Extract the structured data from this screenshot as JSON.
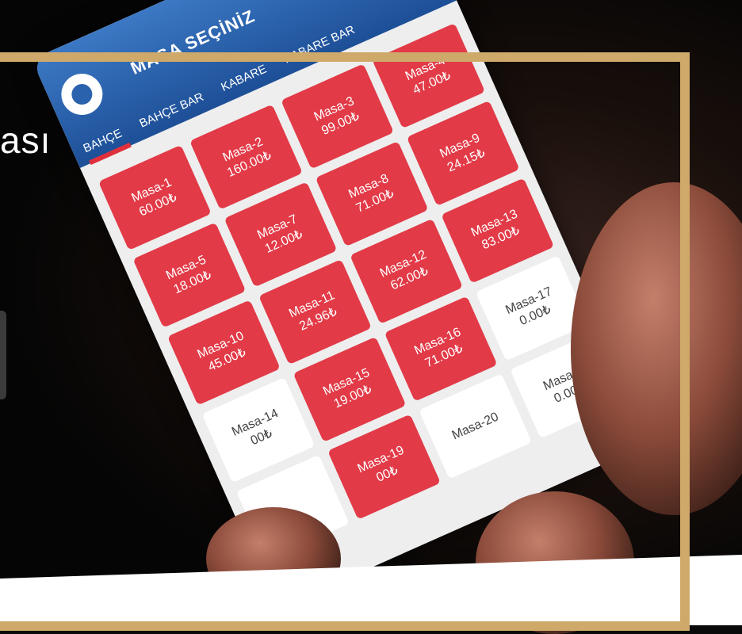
{
  "heading": "ası",
  "app": {
    "title": "MASA SEÇİNİZ",
    "notification_count": "0",
    "tabs": [
      "BAHÇE",
      "BAHÇE BAR",
      "KABARE",
      "KABARE BAR"
    ],
    "tables": [
      {
        "name": "Masa-1",
        "amount": "60.00₺",
        "occupied": true
      },
      {
        "name": "Masa-2",
        "amount": "160.00₺",
        "occupied": true
      },
      {
        "name": "Masa-3",
        "amount": "99.00₺",
        "occupied": true
      },
      {
        "name": "Masa-4",
        "amount": "47.00₺",
        "occupied": true
      },
      {
        "name": "Masa-5",
        "amount": "18.00₺",
        "occupied": true
      },
      {
        "name": "Masa-7",
        "amount": "12.00₺",
        "occupied": true
      },
      {
        "name": "Masa-8",
        "amount": "71.00₺",
        "occupied": true
      },
      {
        "name": "Masa-9",
        "amount": "24.15₺",
        "occupied": true
      },
      {
        "name": "Masa-10",
        "amount": "45.00₺",
        "occupied": true
      },
      {
        "name": "Masa-11",
        "amount": "24.96₺",
        "occupied": true
      },
      {
        "name": "Masa-12",
        "amount": "62.00₺",
        "occupied": true
      },
      {
        "name": "Masa-13",
        "amount": "83.00₺",
        "occupied": true
      },
      {
        "name": "Masa-14",
        "amount": "00₺",
        "occupied": false
      },
      {
        "name": "Masa-15",
        "amount": "19.00₺",
        "occupied": true
      },
      {
        "name": "Masa-16",
        "amount": "71.00₺",
        "occupied": true
      },
      {
        "name": "Masa-17",
        "amount": "0.00₺",
        "occupied": false
      },
      {
        "name": "",
        "amount": "",
        "occupied": false
      },
      {
        "name": "Masa-19",
        "amount": "00₺",
        "occupied": true
      },
      {
        "name": "Masa-20",
        "amount": "",
        "occupied": false
      },
      {
        "name": "Masa-6",
        "amount": "0.00₺",
        "occupied": false
      }
    ]
  },
  "colors": {
    "frame": "#cfa96a",
    "header_blue": "#2a62ad",
    "occupied_red": "#e23a47",
    "empty_white": "#ffffff"
  }
}
